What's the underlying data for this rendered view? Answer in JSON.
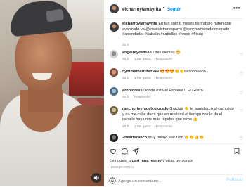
{
  "post": {
    "username": "elcharroylamayrita",
    "separator": "•",
    "follow_label": "Seguir",
    "more_label": "•••",
    "caption": {
      "username": "elcharroylamayrita",
      "text": "En tan solo 6 meses de trabajo miren que avanzado va @joseluistorresparra @ranchoriveradelcolorado #arrendador #caballo #caballos #horse #frison",
      "time": "23 h"
    },
    "comments": [
      {
        "username": "angelreyes8683",
        "text": "I mis dientes 😁",
        "time": "23 h",
        "likes": "1 Me gusta",
        "reply": "Responder"
      },
      {
        "username": "cynthiamartinez949",
        "text": "😍😍😍👏👏bellooooooo",
        "time": "23 h",
        "likes": "1 Me gusta",
        "reply": "Responder"
      },
      {
        "username": "aronloresll",
        "text": "Donde está el Español !! El Güero",
        "time": "23 h",
        "likes": "",
        "reply": "Responder"
      },
      {
        "username": "ranchoriveradelcolorado",
        "text": "Gracias 👏 te agradezco el cumplido y no me cabe duda que en realidad el tiempo nos lo da el caballo hay unos más rápidos que otros 👍",
        "time": "23 h",
        "likes": "1 Me gusta",
        "reply": "Responder"
      },
      {
        "username": "2heartsranch",
        "text": "Muy bueno ese Don 👏👏👍👏",
        "time": "",
        "likes": "",
        "reply": ""
      }
    ],
    "likes": {
      "prefix": "Les gusta a",
      "user": "dari_ana_esme",
      "suffix": "y otras personas"
    },
    "date": "HACE 23 HORAS",
    "comment_placeholder": "Agrega un comentario...",
    "publish_label": "Publicar"
  },
  "icons": {
    "like": "heart-icon",
    "comment": "comment-icon",
    "share": "share-icon",
    "save": "bookmark-icon",
    "emoji": "emoji-icon",
    "sound": "speaker-muted-icon"
  },
  "colors": {
    "accent": "#0095f6",
    "publish": "#b2dffc",
    "muted": "#8e8e8e"
  }
}
